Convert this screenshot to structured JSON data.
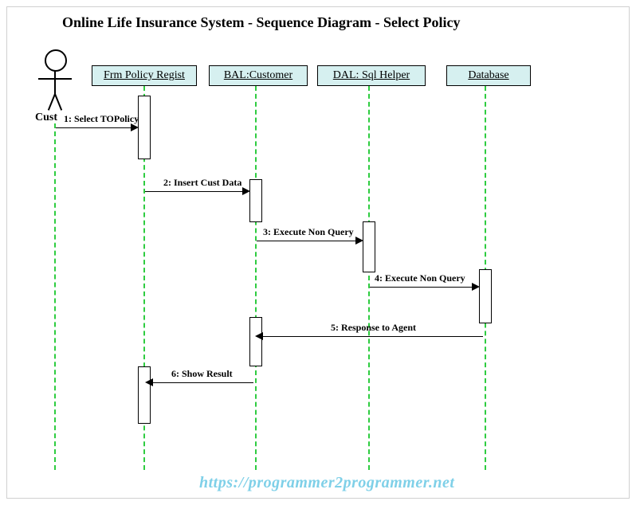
{
  "title": "Online Life Insurance System - Sequence Diagram - Select Policy",
  "actor": {
    "label": "Cust"
  },
  "participants": {
    "frm": "Frm Policy Regist",
    "bal": "BAL:Customer",
    "dal": "DAL: Sql Helper",
    "db": "Database"
  },
  "messages": {
    "m1": "1: Select TOPolicy",
    "m2": "2: Insert Cust Data",
    "m3": "3: Execute Non Query",
    "m4": "4: Execute Non Query",
    "m5": "5: Response to Agent",
    "m6": "6: Show Result"
  },
  "watermark": "https://programmer2programmer.net"
}
